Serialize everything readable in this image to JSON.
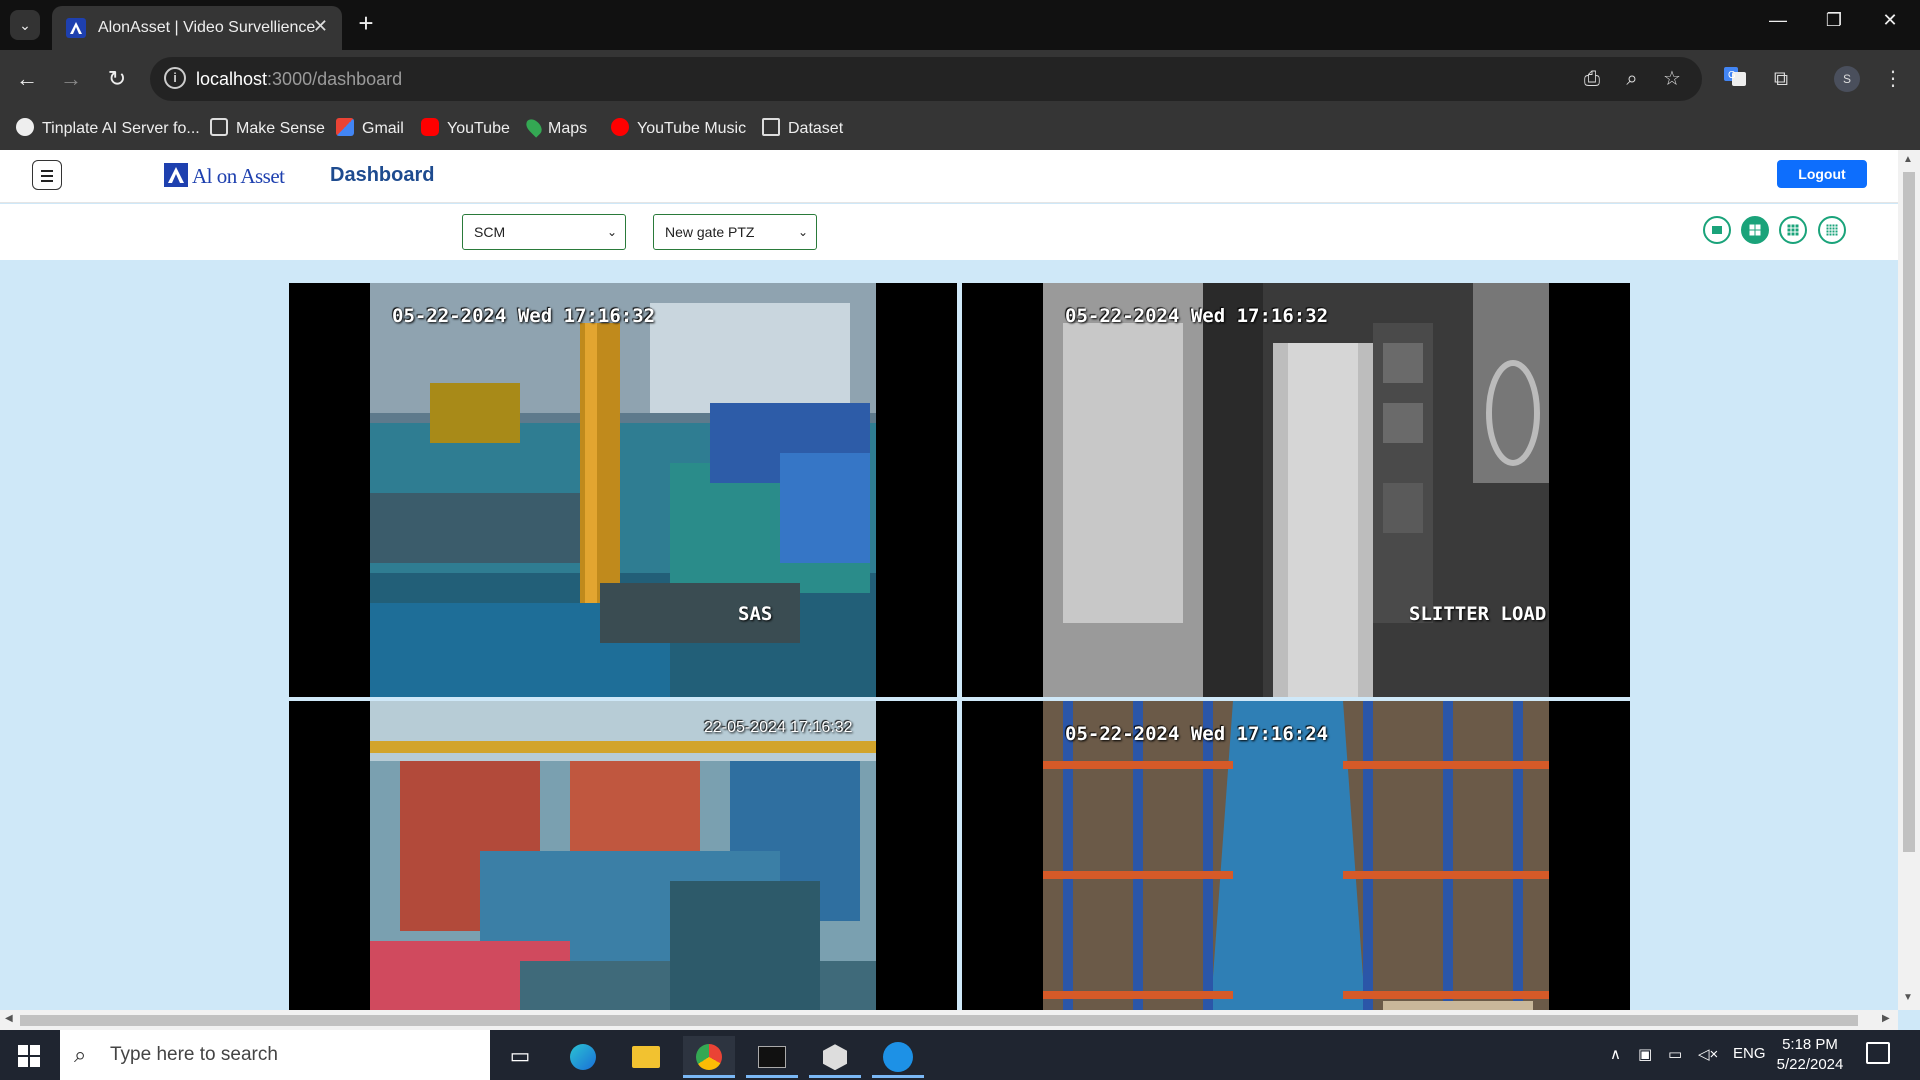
{
  "browser": {
    "tab_title": "AlonAsset | Video Survellience",
    "url_host": "localhost",
    "url_path": ":3000/dashboard",
    "bookmarks": [
      {
        "label": "Tinplate AI Server fo...",
        "icon": "globe-icon",
        "color": "#ffffff"
      },
      {
        "label": "Make Sense",
        "icon": "make-sense-icon",
        "color": "#dddddd"
      },
      {
        "label": "Gmail",
        "icon": "gmail-icon",
        "color": "#ea4335"
      },
      {
        "label": "YouTube",
        "icon": "youtube-icon",
        "color": "#ff0000"
      },
      {
        "label": "Maps",
        "icon": "maps-icon",
        "color": "#34a853"
      },
      {
        "label": "YouTube Music",
        "icon": "youtube-music-icon",
        "color": "#ff0000"
      },
      {
        "label": "Dataset",
        "icon": "folder-icon",
        "color": "#dddddd"
      }
    ],
    "profile_initial": "S"
  },
  "app": {
    "logo_text": "Al on Asset",
    "page_title": "Dashboard",
    "logout_label": "Logout",
    "brand_color": "#1e40af",
    "accent_color": "#1aa37a",
    "filters": {
      "location": "SCM",
      "camera": "New gate PTZ"
    },
    "layout_options": [
      "1x1",
      "2x2",
      "3x3",
      "4x4"
    ],
    "active_layout": "2x2"
  },
  "cameras": [
    {
      "timestamp": "05-22-2024 Wed 17:16:32",
      "label": "SAS",
      "scene": "color-factory"
    },
    {
      "timestamp": "05-22-2024 Wed 17:16:32",
      "label": "SLITTER LOAD",
      "scene": "grayscale-coils"
    },
    {
      "timestamp": "22-05-2024 17:16:32",
      "label": "",
      "scene": "color-warehouse"
    },
    {
      "timestamp": "05-22-2024 Wed 17:16:24",
      "label": "",
      "scene": "color-racks"
    }
  ],
  "taskbar": {
    "search_placeholder": "Type here to search",
    "language": "ENG",
    "time": "5:18 PM",
    "date": "5/22/2024"
  }
}
